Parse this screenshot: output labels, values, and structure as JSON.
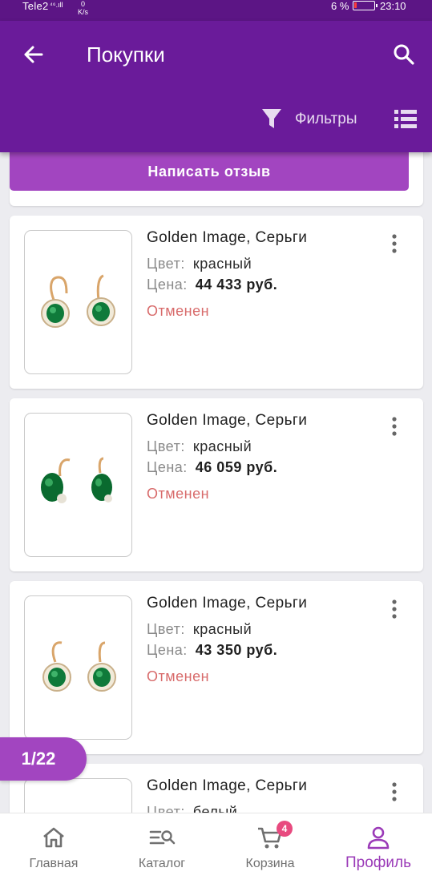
{
  "status_bar": {
    "carrier": "Tele2",
    "signal": "⁴⁶.ıll",
    "speed_top": "0",
    "speed_unit": "K/s",
    "battery": "6 %",
    "time": "23:10"
  },
  "header": {
    "title": "Покупки",
    "filters_label": "Фильтры"
  },
  "review_button": "Написать отзыв",
  "products": [
    {
      "name": "Golden Image, Серьги",
      "color_key": "Цвет:",
      "color_value": "красный",
      "price_key": "Цена:",
      "price_value": "44 433 руб.",
      "status": "Отменен"
    },
    {
      "name": "Golden Image, Серьги",
      "color_key": "Цвет:",
      "color_value": "красный",
      "price_key": "Цена:",
      "price_value": "46 059 руб.",
      "status": "Отменен"
    },
    {
      "name": "Golden Image, Серьги",
      "color_key": "Цвет:",
      "color_value": "красный",
      "price_key": "Цена:",
      "price_value": "43 350 руб.",
      "status": "Отменен"
    },
    {
      "name": "Golden Image, Серьги",
      "color_key": "Цвет:",
      "color_value": "белый"
    }
  ],
  "pager": "1/22",
  "bottom_nav": {
    "items": [
      {
        "label": "Главная",
        "icon": "home-icon"
      },
      {
        "label": "Каталог",
        "icon": "catalog-search-icon"
      },
      {
        "label": "Корзина",
        "icon": "cart-icon"
      },
      {
        "label": "Профиль",
        "icon": "profile-icon"
      }
    ],
    "cart_count": "4",
    "active": "Профиль"
  },
  "colors": {
    "app_bar": "#6a1b9a",
    "accent": "#a245c0",
    "status_canceled": "#d86b6b",
    "cart_badge": "#e84a7f"
  }
}
